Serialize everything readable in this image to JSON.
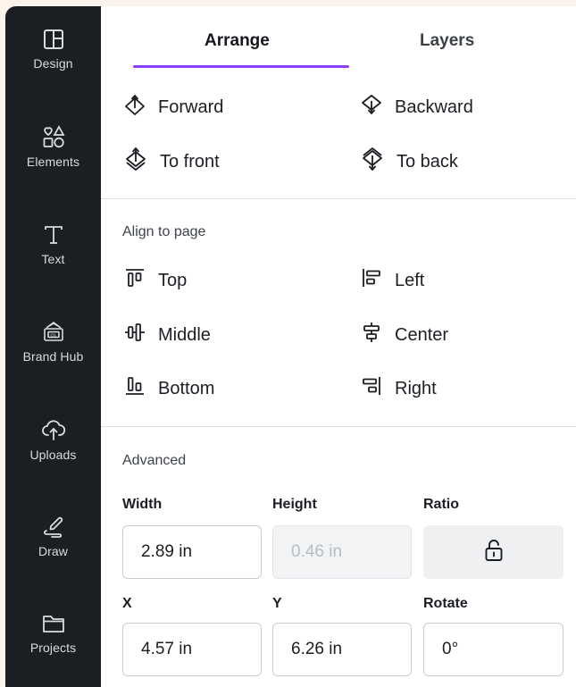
{
  "sidebar": {
    "items": [
      {
        "label": "Design",
        "icon": "layout-icon"
      },
      {
        "label": "Elements",
        "icon": "shapes-icon"
      },
      {
        "label": "Text",
        "icon": "text-icon"
      },
      {
        "label": "Brand Hub",
        "icon": "brand-hub-icon"
      },
      {
        "label": "Uploads",
        "icon": "cloud-upload-icon"
      },
      {
        "label": "Draw",
        "icon": "draw-icon"
      },
      {
        "label": "Projects",
        "icon": "folder-icon"
      }
    ]
  },
  "tabs": {
    "arrange": "Arrange",
    "layers": "Layers",
    "active": "Arrange",
    "accent_color": "#8b3dff"
  },
  "arrange": {
    "forward": "Forward",
    "backward": "Backward",
    "to_front": "To front",
    "to_back": "To back"
  },
  "align": {
    "title": "Align to page",
    "top": "Top",
    "left": "Left",
    "middle": "Middle",
    "center": "Center",
    "bottom": "Bottom",
    "right": "Right"
  },
  "advanced": {
    "title": "Advanced",
    "width_label": "Width",
    "width_value": "2.89 in",
    "height_label": "Height",
    "height_value": "0.46 in",
    "ratio_label": "Ratio",
    "ratio_icon": "unlocked-padlock-icon",
    "x_label": "X",
    "x_value": "4.57 in",
    "y_label": "Y",
    "y_value": "6.26 in",
    "rotate_label": "Rotate",
    "rotate_value": "0°"
  }
}
